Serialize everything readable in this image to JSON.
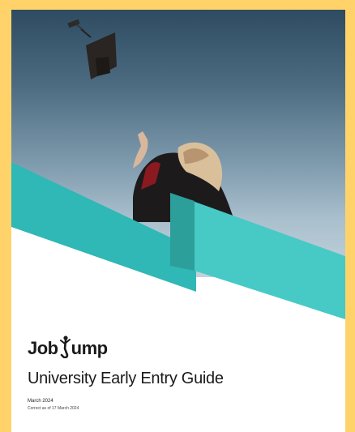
{
  "cover": {
    "brand": {
      "part1": "Job",
      "part2": "ump"
    },
    "title": "University Early Entry Guide",
    "date": "March 2024",
    "note": "Correct as of 17 March 2024"
  },
  "colors": {
    "frame": "#ffd36a",
    "accent_teal": "#3fc0bd",
    "accent_teal_dark": "#2c9f9b",
    "text": "#1a1a1a"
  },
  "icons": [
    "graduation-cap-icon",
    "jumping-person-logo-icon"
  ]
}
